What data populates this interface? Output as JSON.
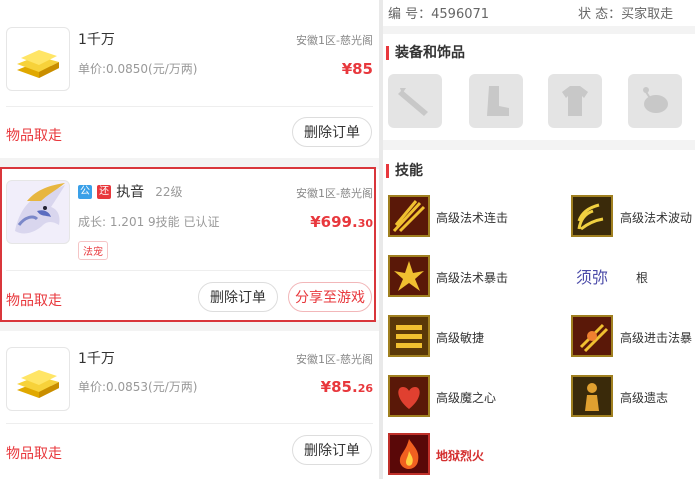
{
  "orders": [
    {
      "title": "1千万",
      "unit_price": "单价:0.0850(元/万两)",
      "server": "安徽1区-慈光阁",
      "price_main": "¥85",
      "price_decimal": "",
      "take_label": "物品取走",
      "delete_label": "删除订单"
    },
    {
      "tag1": "公",
      "tag2": "还",
      "title": "执音",
      "level": "22级",
      "stats": "成长: 1.201  9技能  已认证",
      "chip": "法宠",
      "server": "安徽1区-慈光阁",
      "price_main": "¥699.",
      "price_decimal": "30",
      "take_label": "物品取走",
      "delete_label": "删除订单",
      "share_label": "分享至游戏"
    },
    {
      "title": "1千万",
      "unit_price": "单价:0.0853(元/万两)",
      "server": "安徽1区-慈光阁",
      "price_main": "¥85.",
      "price_decimal": "26",
      "take_label": "物品取走",
      "delete_label": "删除订单"
    }
  ],
  "detail": {
    "id_label": "编  号：",
    "id_value": "4596071",
    "status_label": "状  态：",
    "status_value": "买家取走",
    "equip_title": "装备和饰品",
    "skills_title": "技能",
    "skills": [
      {
        "name": "高级法术连击",
        "icon": "skill-icon",
        "highlight": false
      },
      {
        "name": "高级法术波动",
        "icon": "skill-icon",
        "highlight": false
      },
      {
        "name": "高级法术暴击",
        "icon": "skill-icon",
        "highlight": false
      },
      {
        "name": "须弥",
        "icon": "",
        "highlight": false
      },
      {
        "name": "高级敏捷",
        "icon": "skill-icon",
        "highlight": false
      },
      {
        "name": "高级进击法暴",
        "icon": "skill-icon",
        "highlight": false
      },
      {
        "name": "高级魔之心",
        "icon": "skill-icon",
        "highlight": false
      },
      {
        "name": "高级遗志",
        "icon": "skill-icon",
        "highlight": false
      },
      {
        "name": "地狱烈火",
        "icon": "skill-icon",
        "highlight": true
      }
    ],
    "root_label": "根"
  },
  "colors": {
    "accent": "#e8383d",
    "tag_blue": "#3aa0e8",
    "tag_red": "#e8383d"
  }
}
